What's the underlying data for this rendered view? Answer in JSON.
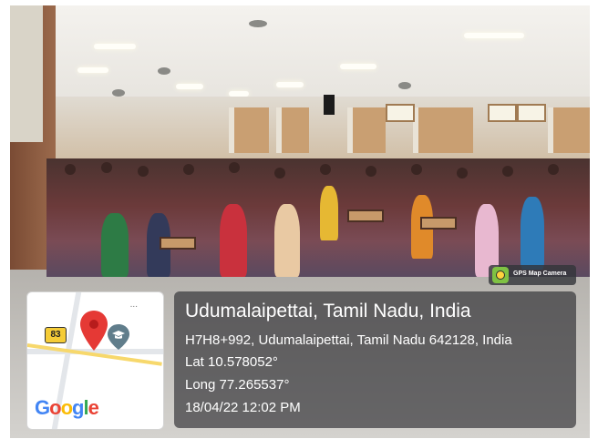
{
  "photo": {
    "description_colors": {
      "wall": "#c99f72",
      "seats": "#c79a6a"
    }
  },
  "camera_badge": {
    "label": "GPS Map Camera",
    "icon": "gps-map-camera-icon"
  },
  "map": {
    "road_badge": "83",
    "logo_text": [
      "G",
      "o",
      "o",
      "g",
      "l",
      "e"
    ],
    "pin_color": "#e53935",
    "icon": "graduation-cap-icon",
    "more_dots": "..."
  },
  "location": {
    "title": "Udumalaipettai, Tamil Nadu, India",
    "address": "H7H8+992, Udumalaipettai, Tamil Nadu 642128, India",
    "latitude": "Lat 10.578052°",
    "longitude": "Long 77.265537°",
    "datetime": "18/04/22 12:02 PM"
  }
}
